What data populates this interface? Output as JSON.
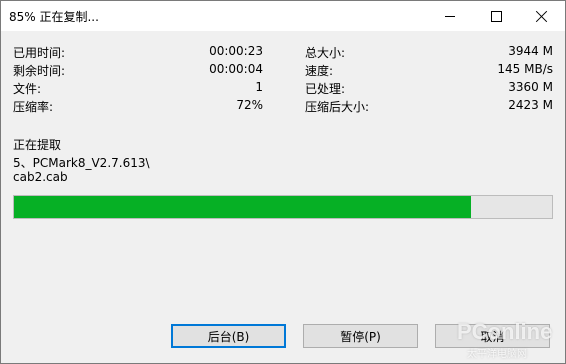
{
  "window": {
    "title": "85% 正在复制..."
  },
  "stats": {
    "left": [
      {
        "label": "已用时间:",
        "value": "00:00:23"
      },
      {
        "label": "剩余时间:",
        "value": "00:00:04"
      },
      {
        "label": "文件:",
        "value": "1"
      },
      {
        "label": "压缩率:",
        "value": "72%"
      }
    ],
    "right": [
      {
        "label": "总大小:",
        "value": "3944 M"
      },
      {
        "label": "速度:",
        "value": "145 MB/s"
      },
      {
        "label": "已处理:",
        "value": "3360 M"
      },
      {
        "label": "压缩后大小:",
        "value": "2423 M"
      }
    ]
  },
  "status": {
    "action": "正在提取",
    "path_line1": "5、PCMark8_V2.7.613\\",
    "path_line2": "cab2.cab"
  },
  "progress": {
    "percent": 85,
    "fill_color": "#06b025"
  },
  "buttons": {
    "background": "后台(B)",
    "pause": "暂停(P)",
    "cancel": "取消"
  },
  "watermark": {
    "brand": "PConline",
    "sub": "太平洋电脑网"
  }
}
